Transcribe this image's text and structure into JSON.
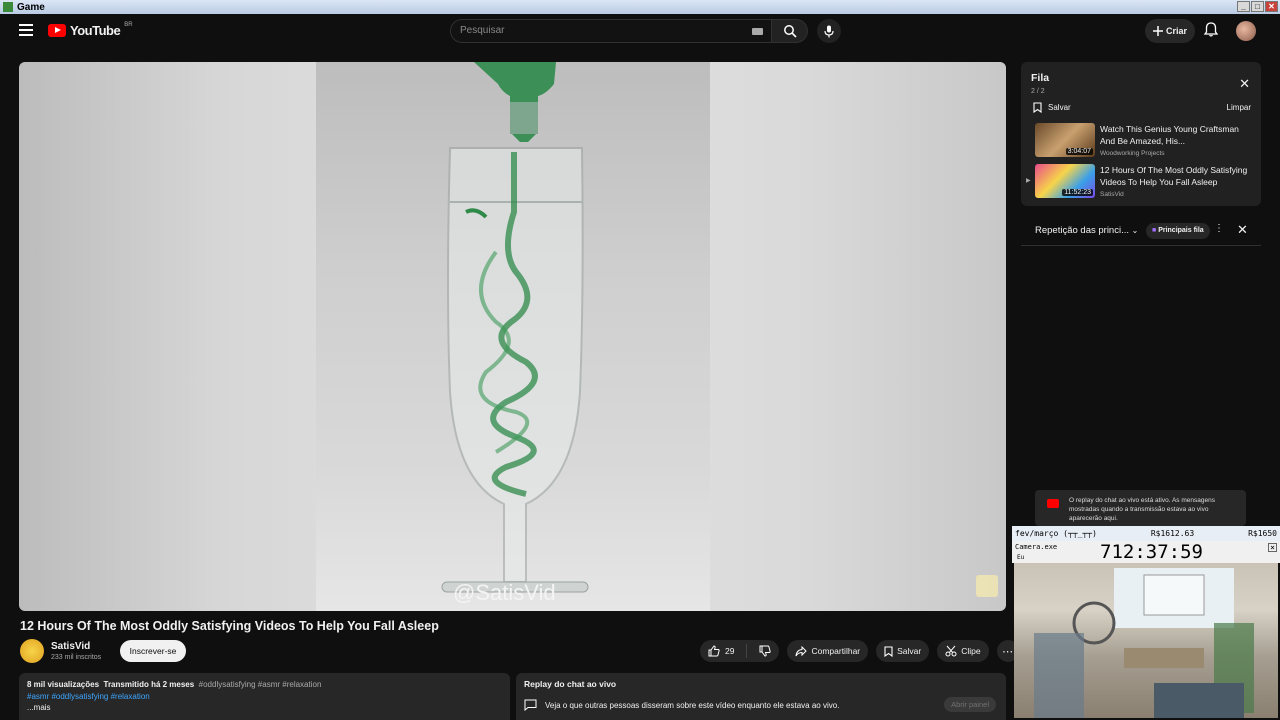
{
  "window": {
    "title": "Game"
  },
  "header": {
    "logo_text": "YouTube",
    "country": "BR",
    "search_placeholder": "Pesquisar",
    "create_label": "Criar"
  },
  "video": {
    "watermark": "@SatisVid",
    "title": "12 Hours Of The Most Oddly Satisfying Videos To Help You Fall Asleep"
  },
  "channel": {
    "name": "SatisVid",
    "subscribers": "233 mil inscritos",
    "subscribe_label": "Inscrever-se"
  },
  "actions": {
    "likes": "29",
    "share": "Compartilhar",
    "save": "Salvar",
    "clip": "Clipe"
  },
  "description": {
    "views": "8 mil visualizações",
    "streamed": "Transmitido há 2 meses",
    "inline_tags": "#oddlysatisfying #asmr #relaxation",
    "tags": "#asmr #oddlysatisfying #relaxation",
    "more": "...mais"
  },
  "chat_replay_card": {
    "title": "Replay do chat ao vivo",
    "text": "Veja o que outras pessoas disseram sobre este vídeo enquanto ele estava ao vivo.",
    "open_label": "Abrir painel"
  },
  "queue": {
    "title": "Fila",
    "count": "2 / 2",
    "save_label": "Salvar",
    "clear_label": "Limpar",
    "items": [
      {
        "title": "Watch This Genius Young Craftsman And Be Amazed, His...",
        "channel": "Woodworking Projects",
        "duration": "3:04:07"
      },
      {
        "title": "12 Hours Of The Most Oddly Satisfying Videos To Help You Fall Asleep",
        "channel": "SatisVid",
        "duration": "11:52:23"
      }
    ]
  },
  "live_chat": {
    "title": "Repetição das princi...",
    "badge": "Principais fila",
    "info": "O replay do chat ao vivo está ativo. As mensagens mostradas quando a transmissão estava ao vivo aparecerão aqui."
  },
  "overlay": {
    "left": "fev/março (┬┬_┬┬)",
    "mid": "R$1612.63",
    "right": "R$1650",
    "app": "Camera.exe",
    "sub": "Eu",
    "timer": "712:37:59"
  },
  "colors": {
    "bg": "#0f0f0f",
    "accent": "#ff0000",
    "link": "#3ea6ff"
  }
}
